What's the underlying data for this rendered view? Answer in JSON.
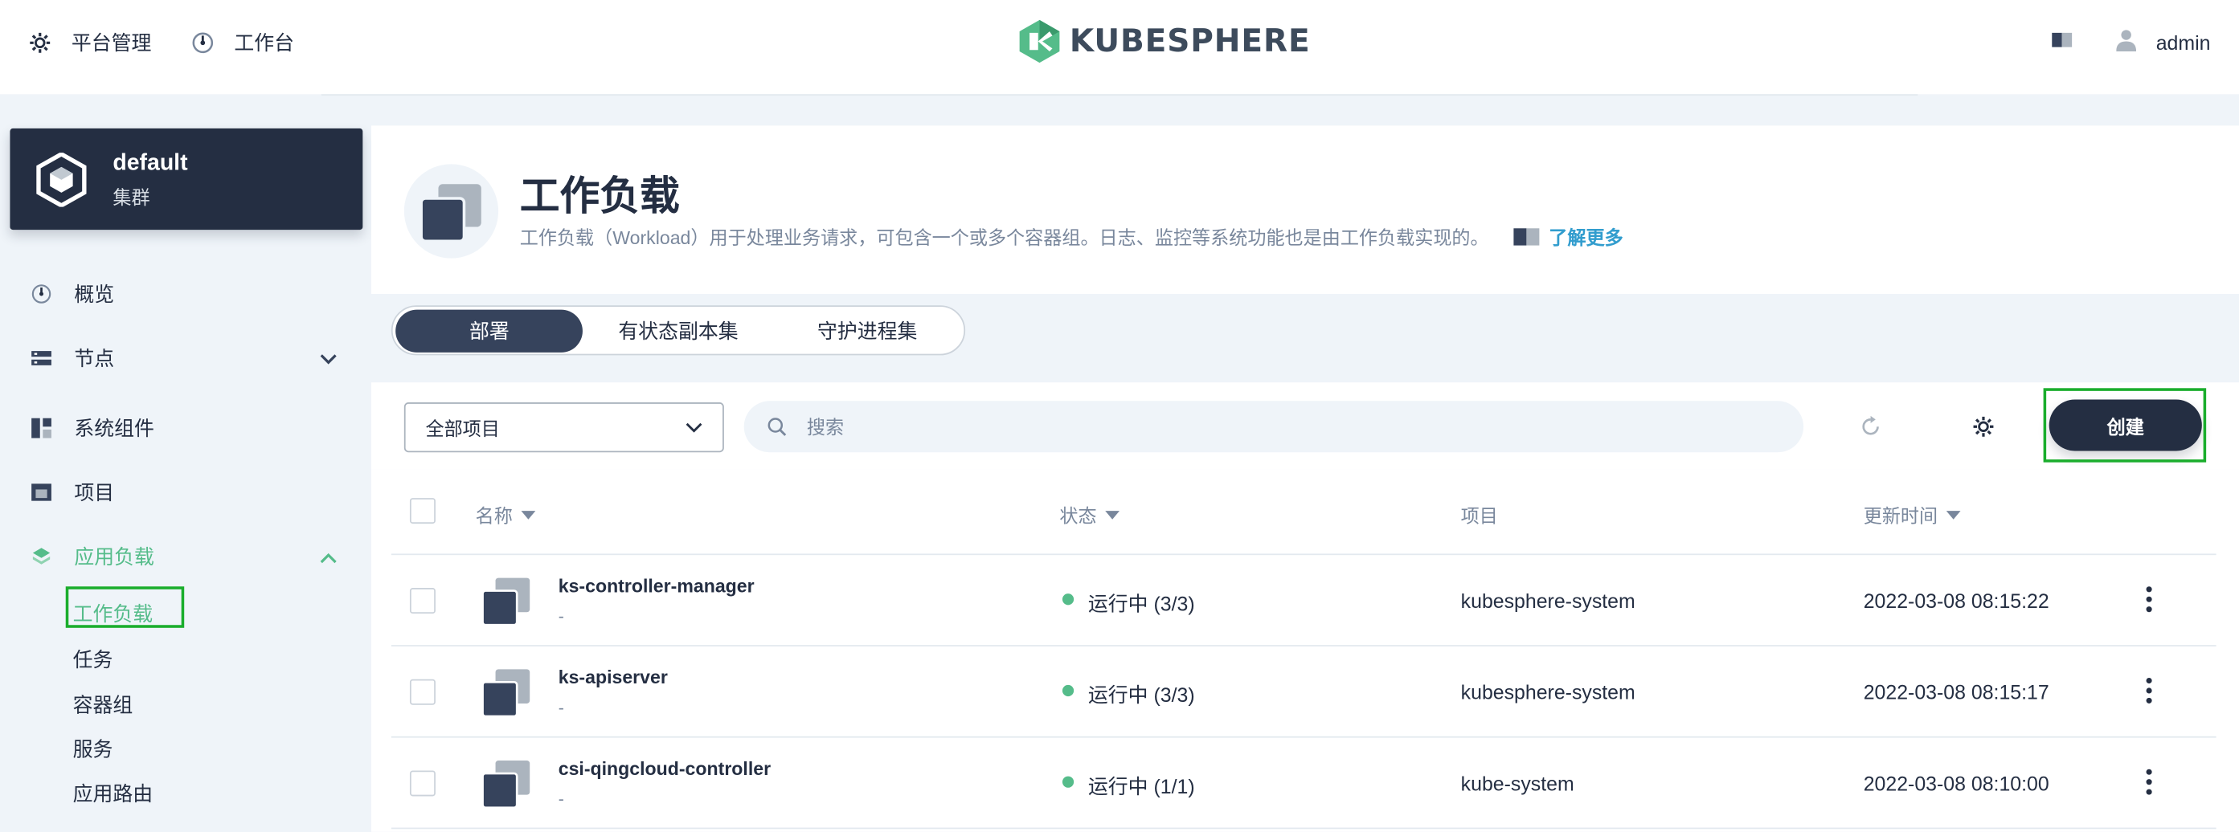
{
  "header": {
    "platform_label": "平台管理",
    "workbench_label": "工作台",
    "logo_text": "KUBESPHERE",
    "user_name": "admin"
  },
  "cluster": {
    "name": "default",
    "type": "集群"
  },
  "sidebar": {
    "items": [
      {
        "label": "概览",
        "icon": "dashboard-icon"
      },
      {
        "label": "节点",
        "icon": "server-icon"
      },
      {
        "label": "系统组件",
        "icon": "components-icon"
      },
      {
        "label": "项目",
        "icon": "project-icon"
      },
      {
        "label": "应用负载",
        "icon": "layers-icon"
      }
    ],
    "sub_items": [
      {
        "label": "工作负载"
      },
      {
        "label": "任务"
      },
      {
        "label": "容器组"
      },
      {
        "label": "服务"
      },
      {
        "label": "应用路由"
      }
    ]
  },
  "banner": {
    "title": "工作负载",
    "description": "工作负载（Workload）用于处理业务请求，可包含一个或多个容器组。日志、监控等系统功能也是由工作负载实现的。",
    "learn_more": "了解更多"
  },
  "tabs": [
    {
      "label": "部署"
    },
    {
      "label": "有状态副本集"
    },
    {
      "label": "守护进程集"
    }
  ],
  "toolbar": {
    "project_select": "全部项目",
    "search_placeholder": "搜索",
    "create_label": "创建"
  },
  "table": {
    "headers": {
      "name": "名称",
      "status": "状态",
      "project": "项目",
      "updated": "更新时间"
    },
    "rows": [
      {
        "name": "ks-controller-manager",
        "sub": "-",
        "status": "运行中 (3/3)",
        "project": "kubesphere-system",
        "updated": "2022-03-08 08:15:22"
      },
      {
        "name": "ks-apiserver",
        "sub": "-",
        "status": "运行中 (3/3)",
        "project": "kubesphere-system",
        "updated": "2022-03-08 08:15:17"
      },
      {
        "name": "csi-qingcloud-controller",
        "sub": "-",
        "status": "运行中 (1/1)",
        "project": "kube-system",
        "updated": "2022-03-08 08:10:00"
      }
    ]
  },
  "colors": {
    "primary_dark": "#242e42",
    "accent_green": "#55bc8a",
    "link_blue": "#329dce",
    "highlight_box": "#1aad2c"
  }
}
